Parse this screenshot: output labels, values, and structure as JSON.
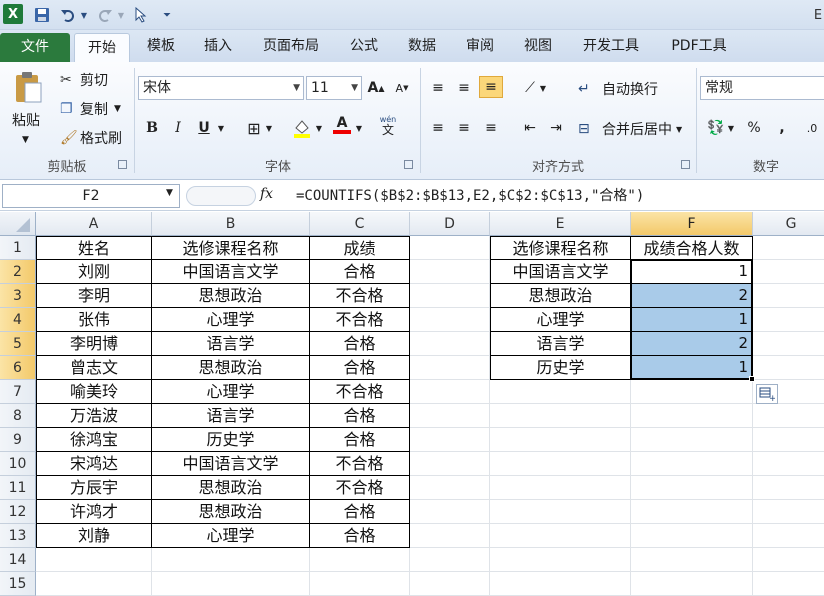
{
  "qat": {
    "app_icon": "X",
    "right_text": "E"
  },
  "tabs": [
    {
      "label": "文件"
    },
    {
      "label": "开始"
    },
    {
      "label": "模板"
    },
    {
      "label": "插入"
    },
    {
      "label": "页面布局"
    },
    {
      "label": "公式"
    },
    {
      "label": "数据"
    },
    {
      "label": "审阅"
    },
    {
      "label": "视图"
    },
    {
      "label": "开发工具"
    },
    {
      "label": "PDF工具"
    }
  ],
  "ribbon": {
    "clipboard": {
      "paste": "粘贴",
      "cut": "剪切",
      "copy": "复制",
      "format_painter": "格式刷",
      "group": "剪贴板"
    },
    "font": {
      "name": "宋体",
      "size": "11",
      "bold": "B",
      "italic": "I",
      "underline": "U",
      "group": "字体",
      "grow": "A",
      "shrink": "A",
      "wen": "wén"
    },
    "alignment": {
      "wrap": "自动换行",
      "merge": "合并后居中",
      "group": "对齐方式"
    },
    "number": {
      "format": "常规",
      "percent": "%",
      "comma": ",",
      "group": "数字"
    }
  },
  "formula_bar": {
    "cell_ref": "F2",
    "fx": "fx",
    "formula": "=COUNTIFS($B$2:$B$13,E2,$C$2:$C$13,\"合格\")"
  },
  "columns": [
    "A",
    "B",
    "C",
    "D",
    "E",
    "F",
    "G"
  ],
  "selected_column": "F",
  "rows": [
    {
      "n": "1",
      "a": "姓名",
      "b": "选修课程名称",
      "c": "成绩",
      "e": "选修课程名称",
      "f": "成绩合格人数"
    },
    {
      "n": "2",
      "a": "刘刚",
      "b": "中国语言文学",
      "c": "合格",
      "e": "中国语言文学",
      "f": "1"
    },
    {
      "n": "3",
      "a": "李明",
      "b": "思想政治",
      "c": "不合格",
      "e": "思想政治",
      "f": "2"
    },
    {
      "n": "4",
      "a": "张伟",
      "b": "心理学",
      "c": "不合格",
      "e": "心理学",
      "f": "1"
    },
    {
      "n": "5",
      "a": "李明博",
      "b": "语言学",
      "c": "合格",
      "e": "语言学",
      "f": "2"
    },
    {
      "n": "6",
      "a": "曾志文",
      "b": "思想政治",
      "c": "合格",
      "e": "历史学",
      "f": "1"
    },
    {
      "n": "7",
      "a": "喻美玲",
      "b": "心理学",
      "c": "不合格",
      "e": "",
      "f": ""
    },
    {
      "n": "8",
      "a": "万浩波",
      "b": "语言学",
      "c": "合格",
      "e": "",
      "f": ""
    },
    {
      "n": "9",
      "a": "徐鸿宝",
      "b": "历史学",
      "c": "合格",
      "e": "",
      "f": ""
    },
    {
      "n": "10",
      "a": "宋鸿达",
      "b": "中国语言文学",
      "c": "不合格",
      "e": "",
      "f": ""
    },
    {
      "n": "11",
      "a": "方辰宇",
      "b": "思想政治",
      "c": "不合格",
      "e": "",
      "f": ""
    },
    {
      "n": "12",
      "a": "许鸿才",
      "b": "思想政治",
      "c": "合格",
      "e": "",
      "f": ""
    },
    {
      "n": "13",
      "a": "刘静",
      "b": "心理学",
      "c": "合格",
      "e": "",
      "f": ""
    },
    {
      "n": "14",
      "a": "",
      "b": "",
      "c": "",
      "e": "",
      "f": ""
    },
    {
      "n": "15",
      "a": "",
      "b": "",
      "c": "",
      "e": "",
      "f": ""
    }
  ],
  "colors": {
    "file_tab": "#2b7a3d",
    "selection": "#a9cbe9",
    "header_selected": "#f3c96a"
  }
}
